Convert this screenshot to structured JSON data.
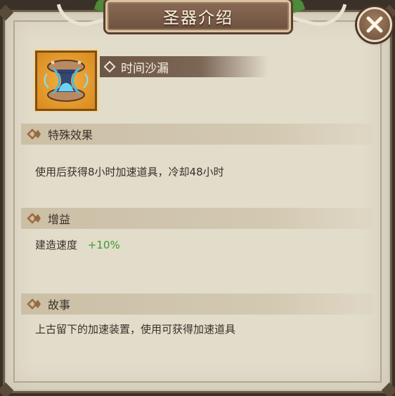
{
  "header": {
    "title": "圣器介绍"
  },
  "artifact": {
    "name": "时间沙漏",
    "icon": "hourglass-icon"
  },
  "sections": {
    "effect": {
      "label": "特殊效果",
      "text": "使用后获得8小时加速道具，冷却48小时"
    },
    "buff": {
      "label": "增益",
      "stat_name": "建造速度",
      "stat_value": "+10%"
    },
    "story": {
      "label": "故事",
      "text": "上古留下的加速装置，使用可获得加速道具"
    }
  },
  "colors": {
    "parchment": "#e2dccb",
    "frame": "#6b5a48",
    "title_bar": "#6e5140",
    "positive": "#3e9a2f",
    "artifact_bg": "#e49a2a"
  },
  "icons": {
    "close": "close-icon",
    "section": "diamond-chevron-icon"
  }
}
